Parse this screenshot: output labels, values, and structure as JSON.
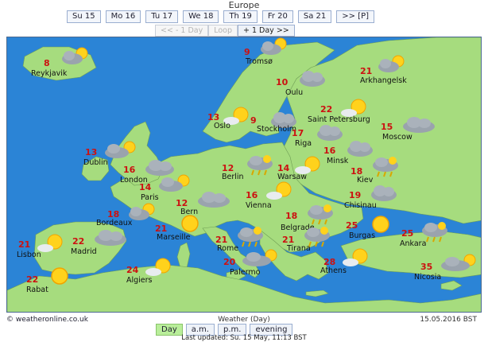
{
  "title": "Europe",
  "day_tabs": [
    {
      "label": "Su 15",
      "active": true
    },
    {
      "label": "Mo 16",
      "active": false
    },
    {
      "label": "Tu 17",
      "active": false
    },
    {
      "label": "We 18",
      "active": false
    },
    {
      "label": "Th 19",
      "active": false
    },
    {
      "label": "Fr 20",
      "active": false
    },
    {
      "label": "Sa 21",
      "active": false
    },
    {
      "label": ">> [P]",
      "active": false
    }
  ],
  "nav": {
    "prev": "<< - 1 Day",
    "loop": "Loop",
    "next": "+ 1 Day >>"
  },
  "cities": [
    {
      "name": "Reykjavik",
      "temp": "8",
      "icon": "cloud-sun-icon"
    },
    {
      "name": "Tromsø",
      "temp": "9",
      "icon": "cloud-sun-icon"
    },
    {
      "name": "Arkhangelsk",
      "temp": "21",
      "icon": "cloud-sun-icon"
    },
    {
      "name": "Oulu",
      "temp": "10",
      "icon": "cloud-icon"
    },
    {
      "name": "Oslo",
      "temp": "13",
      "icon": "sun-cloud-icon"
    },
    {
      "name": "Stockholm",
      "temp": "9",
      "icon": "cloud-icon"
    },
    {
      "name": "Saint Petersburg",
      "temp": "22",
      "icon": "sun-cloud-icon"
    },
    {
      "name": "Riga",
      "temp": "17",
      "icon": "cloud-icon"
    },
    {
      "name": "Moscow",
      "temp": "15",
      "icon": "cloud-icon"
    },
    {
      "name": "Dublin",
      "temp": "13",
      "icon": "cloud-sun-icon"
    },
    {
      "name": "Minsk",
      "temp": "16",
      "icon": "cloud-icon"
    },
    {
      "name": "London",
      "temp": "16",
      "icon": "cloud-icon"
    },
    {
      "name": "Berlin",
      "temp": "12",
      "icon": "rain-cloud-icon"
    },
    {
      "name": "Warsaw",
      "temp": "14",
      "icon": "sun-cloud-icon"
    },
    {
      "name": "Kiev",
      "temp": "18",
      "icon": "rain-cloud-icon"
    },
    {
      "name": "Paris",
      "temp": "14",
      "icon": "cloud-sun-icon"
    },
    {
      "name": "Vienna",
      "temp": "16",
      "icon": "sun-cloud-icon"
    },
    {
      "name": "Bern",
      "temp": "12",
      "icon": "cloud-icon"
    },
    {
      "name": "Chisinau",
      "temp": "19",
      "icon": "cloud-icon"
    },
    {
      "name": "Bordeaux",
      "temp": "18",
      "icon": "cloud-sun-icon"
    },
    {
      "name": "Belgrade",
      "temp": "18",
      "icon": "rain-cloud-icon"
    },
    {
      "name": "Burgas",
      "temp": "25",
      "icon": "sun-icon"
    },
    {
      "name": "Marseille",
      "temp": "21",
      "icon": "sun-icon"
    },
    {
      "name": "Lisbon",
      "temp": "21",
      "icon": "sun-cloud-icon"
    },
    {
      "name": "Madrid",
      "temp": "22",
      "icon": "cloud-icon"
    },
    {
      "name": "Rome",
      "temp": "21",
      "icon": "rain-cloud-icon"
    },
    {
      "name": "Tirana",
      "temp": "21",
      "icon": "rain-cloud-icon"
    },
    {
      "name": "Ankara",
      "temp": "25",
      "icon": "rain-cloud-icon"
    },
    {
      "name": "Palermo",
      "temp": "20",
      "icon": "cloud-sun-icon"
    },
    {
      "name": "Athens",
      "temp": "28",
      "icon": "sun-cloud-icon"
    },
    {
      "name": "Rabat",
      "temp": "22",
      "icon": "sun-icon"
    },
    {
      "name": "Algiers",
      "temp": "24",
      "icon": "sun-cloud-icon"
    },
    {
      "name": "Nicosia",
      "temp": "35",
      "icon": "cloud-sun-icon"
    }
  ],
  "footer": {
    "source": "© weatheronline.co.uk",
    "caption": "Weather (Day)",
    "date": "15.05.2016 BST"
  },
  "periods": [
    {
      "label": "Day",
      "active": true
    },
    {
      "label": "a.m.",
      "active": false
    },
    {
      "label": "p.m.",
      "active": false
    },
    {
      "label": "evening",
      "active": false
    }
  ],
  "last_updated": "Last updated: Su. 15 May, 11:13 BST",
  "colors": {
    "sea": "#2b84d6",
    "land": "#a6dc7e",
    "temperature": "#cc1111",
    "active_tab": "#b9ee9a"
  }
}
